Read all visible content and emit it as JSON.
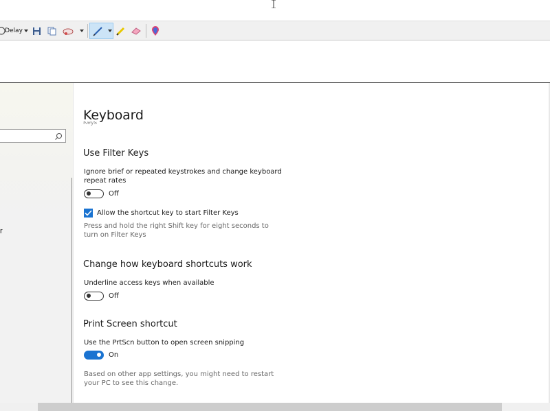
{
  "toolbar": {
    "delay_label": "Delay"
  },
  "sidebar": {
    "search_placeholder": "",
    "truncated_item": "r"
  },
  "page": {
    "title": "Keyboard",
    "clipped_text": "Keys",
    "filter_keys": {
      "heading": "Use Filter Keys",
      "description": "Ignore brief or repeated keystrokes and change keyboard repeat rates",
      "toggle_state": "Off",
      "toggle_on": false,
      "checkbox_label": "Allow the shortcut key to start Filter Keys",
      "checkbox_checked": true,
      "checkbox_note": "Press and hold the right Shift key for eight seconds to turn on Filter Keys"
    },
    "shortcuts": {
      "heading": "Change how keyboard shortcuts work",
      "description": "Underline access keys when available",
      "toggle_state": "Off",
      "toggle_on": false
    },
    "print_screen": {
      "heading": "Print Screen shortcut",
      "description": "Use the PrtScn button to open screen snipping",
      "toggle_state": "On",
      "toggle_on": true,
      "note": "Based on other app settings, you might need to restart your PC to see this change."
    }
  },
  "colors": {
    "accent": "#1a73d1",
    "toolbar_bg": "#f0f0f0",
    "sidebar_bg": "#f2f2f2"
  }
}
